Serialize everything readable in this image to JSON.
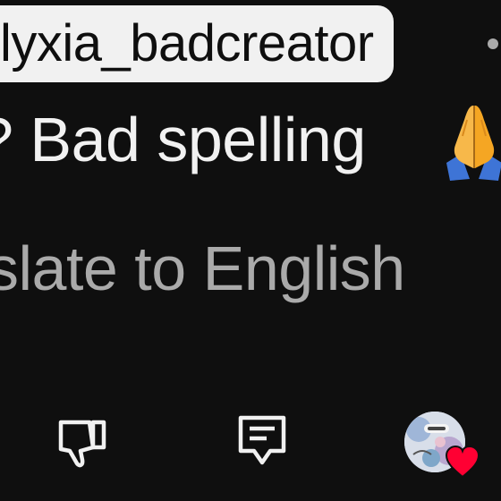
{
  "comment": {
    "username": "lyxia_badcreator",
    "text": "? Bad spelling",
    "emoji": "folded-hands",
    "translate_label": "slate to English"
  },
  "actions": {
    "dislike_icon": "thumbs-down-icon",
    "reply_icon": "comment-icon",
    "creator_heart_icon": "heart-icon"
  },
  "colors": {
    "background": "#0f0f0f",
    "chip_bg": "#f1f1f1",
    "primary_text": "#f1f1f1",
    "secondary_text": "#aaaaaa",
    "heart": "#ff0033"
  }
}
